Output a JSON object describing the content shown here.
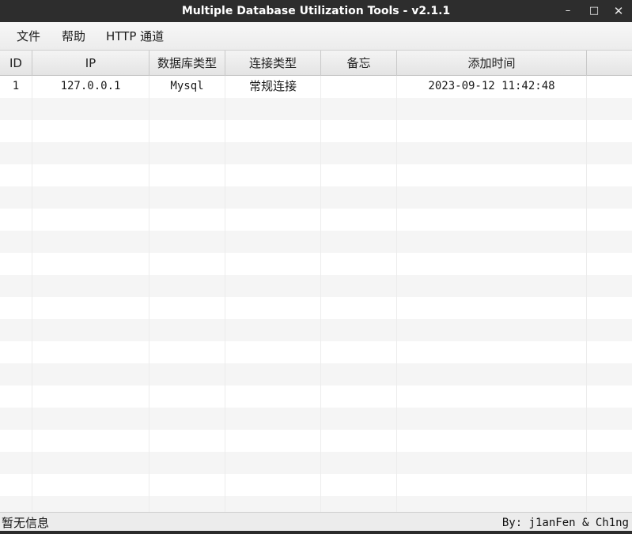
{
  "window": {
    "title": "Multiple Database Utilization Tools - v2.1.1",
    "controls": {
      "minimize": "–",
      "maximize": "□",
      "close": "✕"
    }
  },
  "menubar": {
    "items": [
      {
        "label": "文件"
      },
      {
        "label": "帮助"
      },
      {
        "label": "HTTP 通道"
      }
    ]
  },
  "table": {
    "columns": [
      "ID",
      "IP",
      "数据库类型",
      "连接类型",
      "备忘",
      "添加时间",
      ""
    ],
    "rows": [
      {
        "id": "1",
        "ip": "127.0.0.1",
        "db_type": "Mysql",
        "conn_type": "常规连接",
        "memo": "",
        "added": "2023-09-12 11:42:48"
      }
    ]
  },
  "statusbar": {
    "message": "暂无信息",
    "credit": "By: j1anFen & Ch1ng"
  },
  "colors": {
    "titlebar": "#2d2d2d",
    "row_alt": "#f5f5f5",
    "header_bg": "#e9e9e9"
  }
}
